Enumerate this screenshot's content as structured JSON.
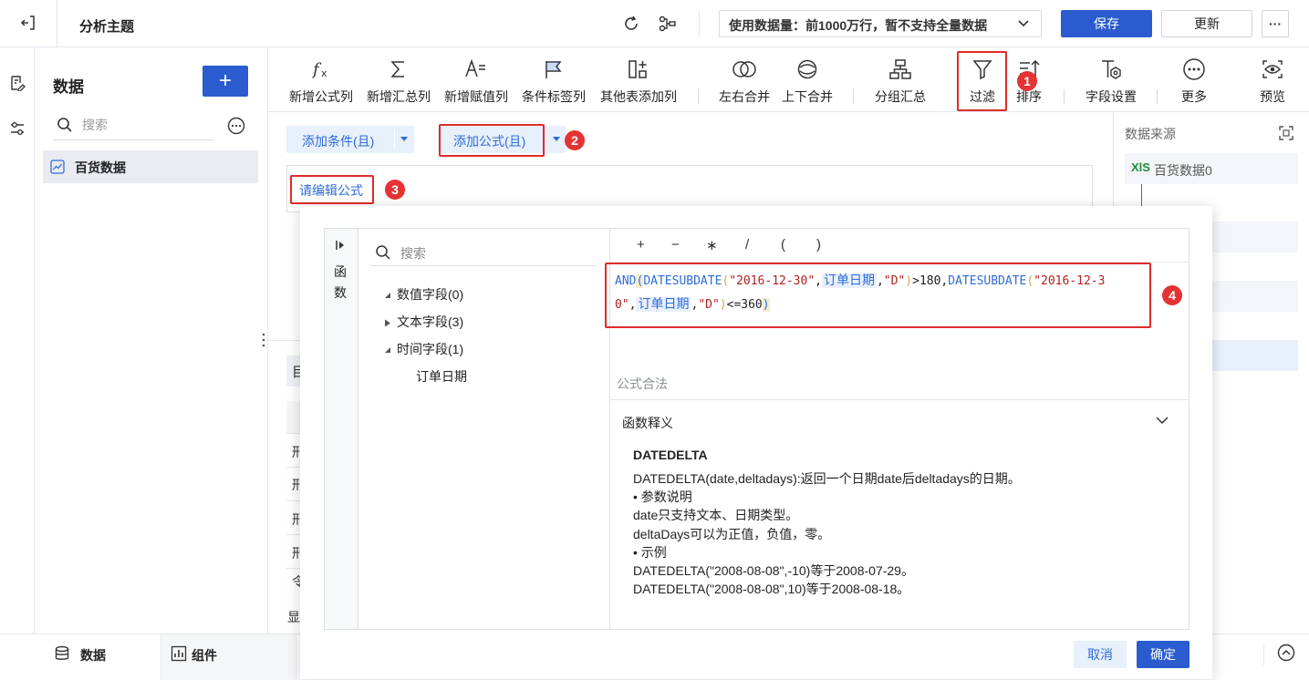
{
  "header": {
    "title": "分析主题",
    "data_limit": "使用数据量：前1000万行，暂不支持全量数据",
    "save_label": "保存",
    "update_label": "更新",
    "more_label": "···"
  },
  "left_panel": {
    "title": "数据",
    "add_label": "+",
    "search_placeholder": "搜索",
    "dataset": "百货数据"
  },
  "toolbar": {
    "items": [
      {
        "label": "新增公式列",
        "icon": "formula-icon"
      },
      {
        "label": "新增汇总列",
        "icon": "sigma-icon"
      },
      {
        "label": "新增赋值列",
        "icon": "assign-icon"
      },
      {
        "label": "条件标签列",
        "icon": "flag-icon"
      },
      {
        "label": "其他表添加列",
        "icon": "add-column-icon"
      },
      {
        "label": "左右合并",
        "icon": "merge-horizontal-icon"
      },
      {
        "label": "上下合并",
        "icon": "merge-vertical-icon"
      },
      {
        "label": "分组汇总",
        "icon": "group-icon"
      },
      {
        "label": "过滤",
        "icon": "filter-icon"
      },
      {
        "label": "排序",
        "icon": "sort-icon"
      },
      {
        "label": "字段设置",
        "icon": "field-settings-icon"
      },
      {
        "label": "更多",
        "icon": "more-icon"
      },
      {
        "label": "预览",
        "icon": "preview-icon"
      }
    ]
  },
  "filter": {
    "add_condition": "添加条件(且)",
    "add_formula": "添加公式(且)",
    "edit_formula": "请编辑公式"
  },
  "right_panel": {
    "title": "数据来源",
    "source": "百货数据0"
  },
  "editor": {
    "side_tab": [
      "函",
      "数"
    ],
    "search_placeholder": "搜索",
    "tree": [
      {
        "label": "数值字段(0)",
        "expanded": true
      },
      {
        "label": "文本字段(3)",
        "expanded": false
      },
      {
        "label": "时间字段(1)",
        "expanded": true
      }
    ],
    "tree_child": "订单日期",
    "operators": [
      "+",
      "−",
      "∗",
      "/",
      "(",
      ")"
    ],
    "formula": {
      "line1": [
        "AND",
        "(",
        "DATESUBDATE",
        "(",
        "\"2016-12-30\"",
        ",",
        "订单日期",
        ",",
        "\"D\"",
        ")",
        ">180,",
        "DATESUBDATE",
        "(",
        "\"2016-12-3"
      ],
      "line2": [
        "0\"",
        ",",
        "订单日期",
        ",",
        "\"D\"",
        ")",
        "<=360",
        ")"
      ]
    },
    "status": "公式合法",
    "help_title": "函数释义",
    "help_func": "DATEDELTA",
    "help_lines": [
      "DATEDELTA(date,deltadays):返回一个日期date后deltadays的日期。",
      "• 参数说明",
      "date只支持文本、日期类型。",
      "deltaDays可以为正值，负值，零。",
      "• 示例",
      "DATEDELTA(\"2008-08-08\",-10)等于2008-07-29。",
      "DATEDELTA(\"2008-08-08\",10)等于2008-08-18。"
    ],
    "cancel_label": "取消",
    "ok_label": "确定"
  },
  "bg_partial": {
    "table_chars": [
      "目",
      "刑",
      "刑",
      "刑",
      "刑",
      "令"
    ],
    "show_label": "显"
  },
  "badges": [
    "1",
    "2",
    "3",
    "4"
  ],
  "bottom_tabs": [
    {
      "label": "数据",
      "icon": "database-icon"
    },
    {
      "label": "组件",
      "icon": "chart-icon"
    }
  ],
  "colors": {
    "primary": "#2a5ccf",
    "accent_text": "#2f6bd8",
    "highlight": "#e02b2b"
  }
}
